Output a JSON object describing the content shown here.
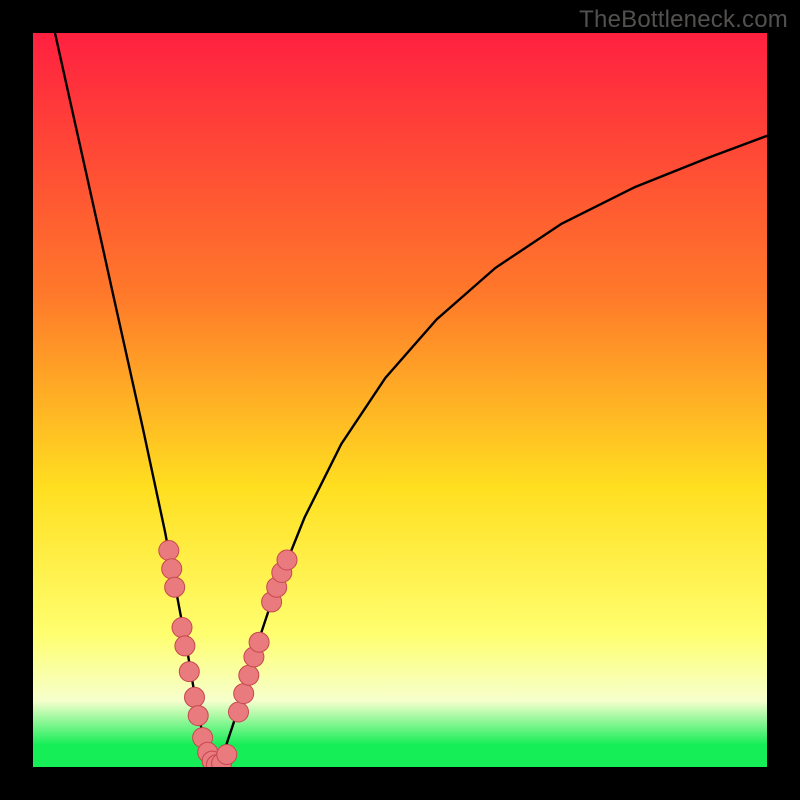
{
  "watermark": "TheBottleneck.com",
  "colors": {
    "bg_black": "#000000",
    "grad_top": "#ff2040",
    "grad_mid_upper": "#ff7a2a",
    "grad_mid": "#ffdf20",
    "grad_mid_lower": "#ffff70",
    "grad_pale": "#f6ffcd",
    "grad_green": "#16ee57",
    "curve": "#000000",
    "dot_fill": "#e97a7e",
    "dot_stroke": "#c6474f"
  },
  "chart_data": {
    "type": "line",
    "title": "",
    "xlabel": "",
    "ylabel": "",
    "xlim": [
      0,
      100
    ],
    "ylim": [
      0,
      100
    ],
    "series": [
      {
        "name": "bottleneck-curve",
        "x": [
          3,
          5,
          7,
          9,
          11,
          13,
          15,
          16.5,
          18,
          19.5,
          21,
          22,
          23,
          24,
          25,
          26,
          28,
          30,
          33,
          37,
          42,
          48,
          55,
          63,
          72,
          82,
          92,
          100
        ],
        "y": [
          100,
          91,
          82,
          73,
          64,
          55,
          46,
          39,
          32,
          24,
          16,
          10,
          5,
          2,
          0,
          2,
          8,
          15,
          24,
          34,
          44,
          53,
          61,
          68,
          74,
          79,
          83,
          86
        ]
      }
    ],
    "marker_clusters": [
      {
        "name": "left-branch-dots",
        "points": [
          {
            "x": 18.5,
            "y": 29.5
          },
          {
            "x": 18.9,
            "y": 27.0
          },
          {
            "x": 19.3,
            "y": 24.5
          },
          {
            "x": 20.3,
            "y": 19.0
          },
          {
            "x": 20.7,
            "y": 16.5
          },
          {
            "x": 21.3,
            "y": 13.0
          },
          {
            "x": 22.0,
            "y": 9.5
          },
          {
            "x": 22.5,
            "y": 7.0
          },
          {
            "x": 23.1,
            "y": 4.0
          },
          {
            "x": 23.8,
            "y": 2.0
          },
          {
            "x": 24.4,
            "y": 0.8
          }
        ]
      },
      {
        "name": "valley-dots",
        "points": [
          {
            "x": 25.0,
            "y": 0.3
          },
          {
            "x": 25.7,
            "y": 0.5
          },
          {
            "x": 26.4,
            "y": 1.7
          }
        ]
      },
      {
        "name": "right-branch-dots",
        "points": [
          {
            "x": 28.0,
            "y": 7.5
          },
          {
            "x": 28.7,
            "y": 10.0
          },
          {
            "x": 29.4,
            "y": 12.5
          },
          {
            "x": 30.1,
            "y": 15.0
          },
          {
            "x": 30.8,
            "y": 17.0
          },
          {
            "x": 32.5,
            "y": 22.5
          },
          {
            "x": 33.2,
            "y": 24.5
          },
          {
            "x": 33.9,
            "y": 26.5
          },
          {
            "x": 34.6,
            "y": 28.2
          }
        ]
      }
    ]
  }
}
